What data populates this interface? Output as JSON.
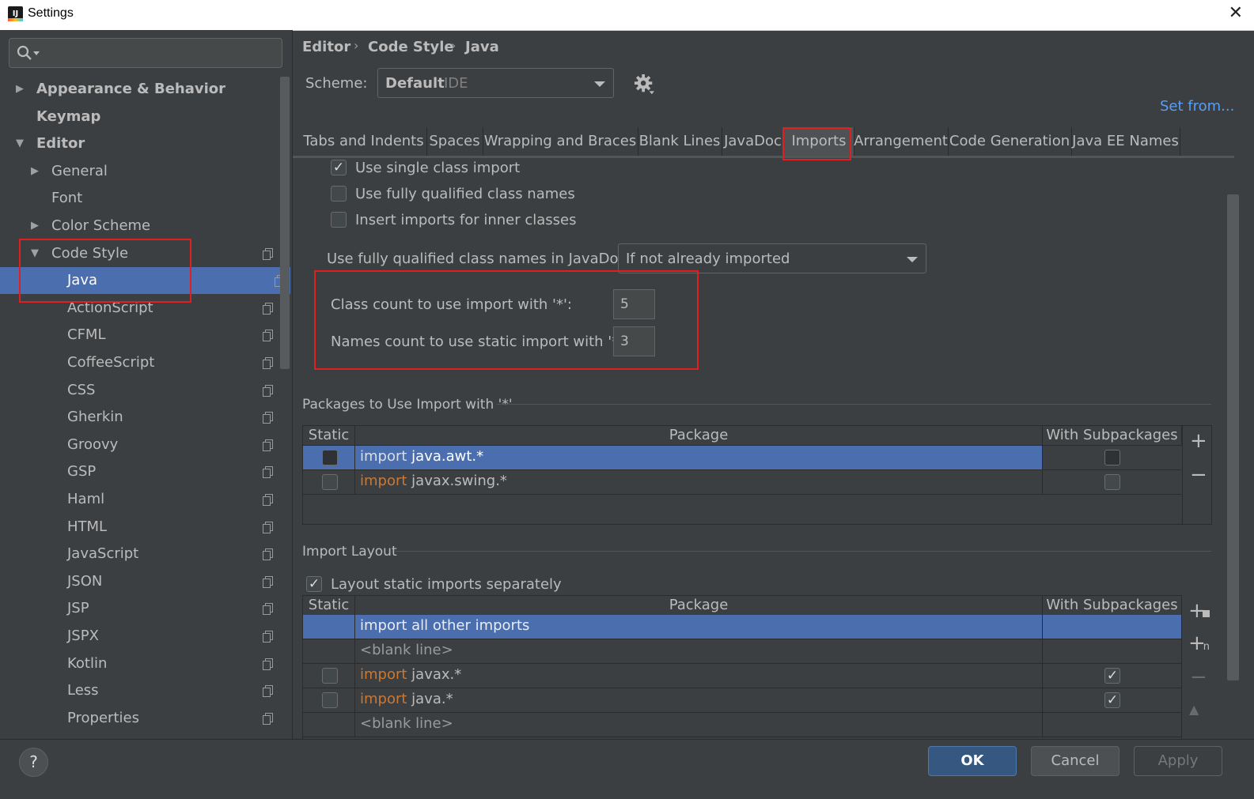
{
  "window": {
    "title": "Settings",
    "close_glyph": "✕"
  },
  "sidebar": {
    "items": [
      {
        "label": "Appearance & Behavior",
        "level": 0,
        "arrow": "▶",
        "bold": true
      },
      {
        "label": "Keymap",
        "level": 0,
        "arrow": "",
        "bold": true
      },
      {
        "label": "Editor",
        "level": 0,
        "arrow": "▼",
        "bold": true
      },
      {
        "label": "General",
        "level": 1,
        "arrow": "▶"
      },
      {
        "label": "Font",
        "level": 1,
        "arrow": ""
      },
      {
        "label": "Color Scheme",
        "level": 1,
        "arrow": "▶"
      },
      {
        "label": "Code Style",
        "level": 1,
        "arrow": "▼",
        "copy": true
      },
      {
        "label": "Java",
        "level": 2,
        "selected": true,
        "copy": true
      },
      {
        "label": "ActionScript",
        "level": 2,
        "copy": true
      },
      {
        "label": "CFML",
        "level": 2,
        "copy": true
      },
      {
        "label": "CoffeeScript",
        "level": 2,
        "copy": true
      },
      {
        "label": "CSS",
        "level": 2,
        "copy": true
      },
      {
        "label": "Gherkin",
        "level": 2,
        "copy": true
      },
      {
        "label": "Groovy",
        "level": 2,
        "copy": true
      },
      {
        "label": "GSP",
        "level": 2,
        "copy": true
      },
      {
        "label": "Haml",
        "level": 2,
        "copy": true
      },
      {
        "label": "HTML",
        "level": 2,
        "copy": true
      },
      {
        "label": "JavaScript",
        "level": 2,
        "copy": true
      },
      {
        "label": "JSON",
        "level": 2,
        "copy": true
      },
      {
        "label": "JSP",
        "level": 2,
        "copy": true
      },
      {
        "label": "JSPX",
        "level": 2,
        "copy": true
      },
      {
        "label": "Kotlin",
        "level": 2,
        "copy": true
      },
      {
        "label": "Less",
        "level": 2,
        "copy": true
      },
      {
        "label": "Properties",
        "level": 2,
        "copy": true
      }
    ]
  },
  "breadcrumb": {
    "items": [
      "Editor",
      "Code Style",
      "Java"
    ],
    "sep": "›"
  },
  "scheme": {
    "label": "Scheme:",
    "value": "Default",
    "suffix": "IDE",
    "set_from": "Set from..."
  },
  "tabs": [
    "Tabs and Indents",
    "Spaces",
    "Wrapping and Braces",
    "Blank Lines",
    "JavaDoc",
    "Imports",
    "Arrangement",
    "Code Generation",
    "Java EE Names"
  ],
  "active_tab": "Imports",
  "options": {
    "single_class_import": {
      "label": "Use single class import",
      "checked": true
    },
    "fully_qualified": {
      "label": "Use fully qualified class names",
      "checked": false
    },
    "inner_classes": {
      "label": "Insert imports for inner classes",
      "checked": false
    },
    "javadoc_label": "Use fully qualified class names in JavaDoc:",
    "javadoc_value": "If not already imported",
    "class_count_label": "Class count to use import with '*':",
    "class_count_value": "5",
    "names_count_label": "Names count to use static import with '*':",
    "names_count_value": "3"
  },
  "packages_section": {
    "title": "Packages to Use Import with '*'",
    "headers": {
      "static": "Static",
      "package": "Package",
      "with_sub": "With Subpackages"
    },
    "rows": [
      {
        "keyword": "import",
        "package": "java.awt.*",
        "static": false,
        "with_sub": false,
        "selected": true
      },
      {
        "keyword": "import",
        "package": "javax.swing.*",
        "static": false,
        "with_sub": false
      }
    ],
    "tools": {
      "add": "+",
      "remove": "−"
    }
  },
  "layout_section": {
    "title": "Import Layout",
    "layout_static": {
      "label": "Layout static imports separately",
      "checked": true
    },
    "headers": {
      "static": "Static",
      "package": "Package",
      "with_sub": "With Subpackages"
    },
    "rows": [
      {
        "text": "import all other imports",
        "selected": true
      },
      {
        "text": "<blank line>",
        "blank": true
      },
      {
        "keyword": "import",
        "package": "javax.*",
        "static": false,
        "with_sub": true
      },
      {
        "keyword": "import",
        "package": "java.*",
        "static": false,
        "with_sub": true
      },
      {
        "text": "<blank line>",
        "blank": true
      }
    ],
    "tools": {
      "add_package": "+",
      "add_blank": "+",
      "remove": "−",
      "up": "▲"
    }
  },
  "buttons": {
    "help": "?",
    "ok": "OK",
    "cancel": "Cancel",
    "apply": "Apply"
  },
  "colors": {
    "bg": "#3c3f41",
    "selection": "#4b6eaf",
    "keyword": "#cc7832",
    "link": "#589df6",
    "highlight": "#e02020"
  }
}
